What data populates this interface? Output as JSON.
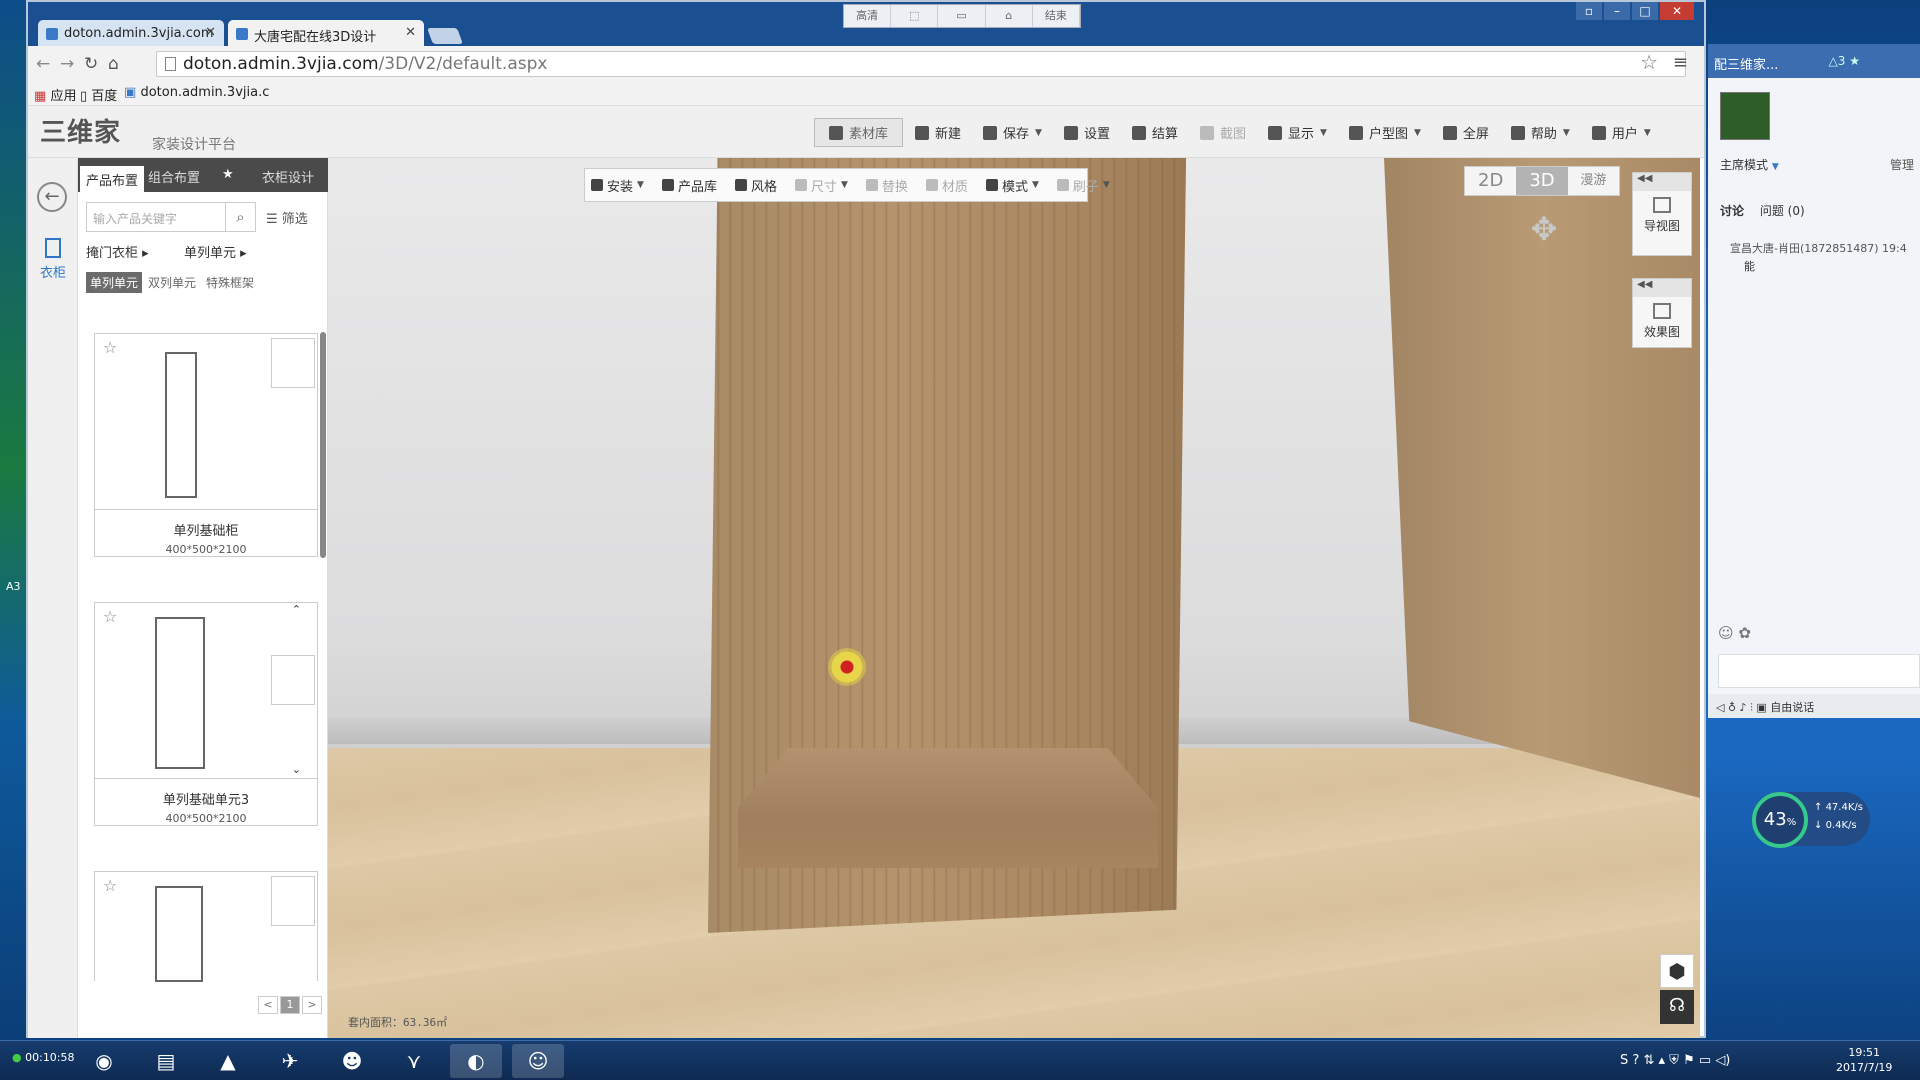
{
  "browser": {
    "tabs": [
      {
        "title": "doton.admin.3vjia.com"
      },
      {
        "title": "大唐宅配在线3D设计"
      }
    ],
    "url_host": "doton.admin.3vjia.com",
    "url_path": "/3D/V2/default.aspx",
    "bookmarks": [
      "应用",
      "百度",
      "doton.admin.3vjia.c"
    ],
    "recording_bar": [
      "高清",
      "⬚",
      "▭",
      "⌂",
      "结束"
    ],
    "window_controls": [
      "▫",
      "–",
      "□",
      "✕"
    ]
  },
  "app": {
    "logo": "三维家",
    "slogan": "家装设计平台",
    "menu": [
      {
        "label": "素材库",
        "icon": "cloud-icon",
        "style": "boxed"
      },
      {
        "label": "新建",
        "icon": "new-file-icon"
      },
      {
        "label": "保存",
        "icon": "save-icon",
        "has_caret": true
      },
      {
        "label": "设置",
        "icon": "gear-icon"
      },
      {
        "label": "结算",
        "icon": "cart-icon"
      },
      {
        "label": "截图",
        "icon": "scissors-icon",
        "disabled": true
      },
      {
        "label": "显示",
        "icon": "grid-icon",
        "has_caret": true
      },
      {
        "label": "户型图",
        "icon": "image-icon",
        "has_caret": true
      },
      {
        "label": "全屏",
        "icon": "fullscreen-icon"
      },
      {
        "label": "帮助",
        "icon": "help-icon",
        "has_caret": true
      },
      {
        "label": "用户",
        "icon": "user-icon",
        "has_caret": true
      }
    ]
  },
  "leftnav": {
    "back_icon": "←",
    "active_category": "衣柜"
  },
  "panel": {
    "tabs": [
      "产品布置",
      "组合布置",
      "★",
      "衣柜设计"
    ],
    "active_tab": "产品布置",
    "search_placeholder": "输入产品关键字",
    "search_icon": "⌕",
    "filter_label": "筛选",
    "breadcrumbs": [
      "掩门衣柜",
      "单列单元"
    ],
    "subtabs": [
      "单列单元",
      "双列单元",
      "特殊框架"
    ],
    "active_subtab": "单列单元",
    "products": [
      {
        "name": "单列基础柜",
        "dims": "400*500*2100"
      },
      {
        "name": "单列基础单元3",
        "dims": "400*500*2100"
      },
      {
        "name": "",
        "dims": ""
      }
    ],
    "pager": [
      "<",
      "1",
      ">"
    ],
    "collapse_label": "»"
  },
  "viewport": {
    "toolbar": [
      {
        "label": "安装",
        "icon": "plus-icon",
        "has_caret": true
      },
      {
        "label": "产品库",
        "icon": "chair-icon"
      },
      {
        "label": "风格",
        "icon": "palette-icon"
      },
      {
        "label": "尺寸",
        "icon": "ruler-icon",
        "has_caret": true,
        "disabled": true
      },
      {
        "label": "替换",
        "icon": "swap-icon",
        "disabled": true
      },
      {
        "label": "材质",
        "icon": "material-icon",
        "disabled": true
      },
      {
        "label": "模式",
        "icon": "pointer-icon",
        "has_caret": true
      },
      {
        "label": "刷子",
        "icon": "brush-icon",
        "has_caret": true,
        "disabled": true
      }
    ],
    "view_modes": [
      "2D",
      "3D",
      "漫游"
    ],
    "active_view": "3D",
    "side_buttons": [
      {
        "label": "导视图",
        "icon": "home-icon"
      },
      {
        "label": "效果图",
        "icon": "camera-icon"
      }
    ],
    "area_text": "套内面积：63.36㎡"
  },
  "chat": {
    "title": "配三维家...",
    "count": "△3 ★",
    "host_mode": "主席模式",
    "manage": "管理",
    "tabs": [
      "讨论",
      "问题 (0)"
    ],
    "message_sender": "宣昌大唐-肖田(1872851487) 19:4",
    "message_text": "能",
    "voice_label": "自由说话"
  },
  "network": {
    "percent": "43",
    "up": "47.4K/s",
    "down": "0.4K/s"
  },
  "taskbar": {
    "timer": "00:10:58",
    "time": "19:51",
    "date": "2017/7/19"
  }
}
